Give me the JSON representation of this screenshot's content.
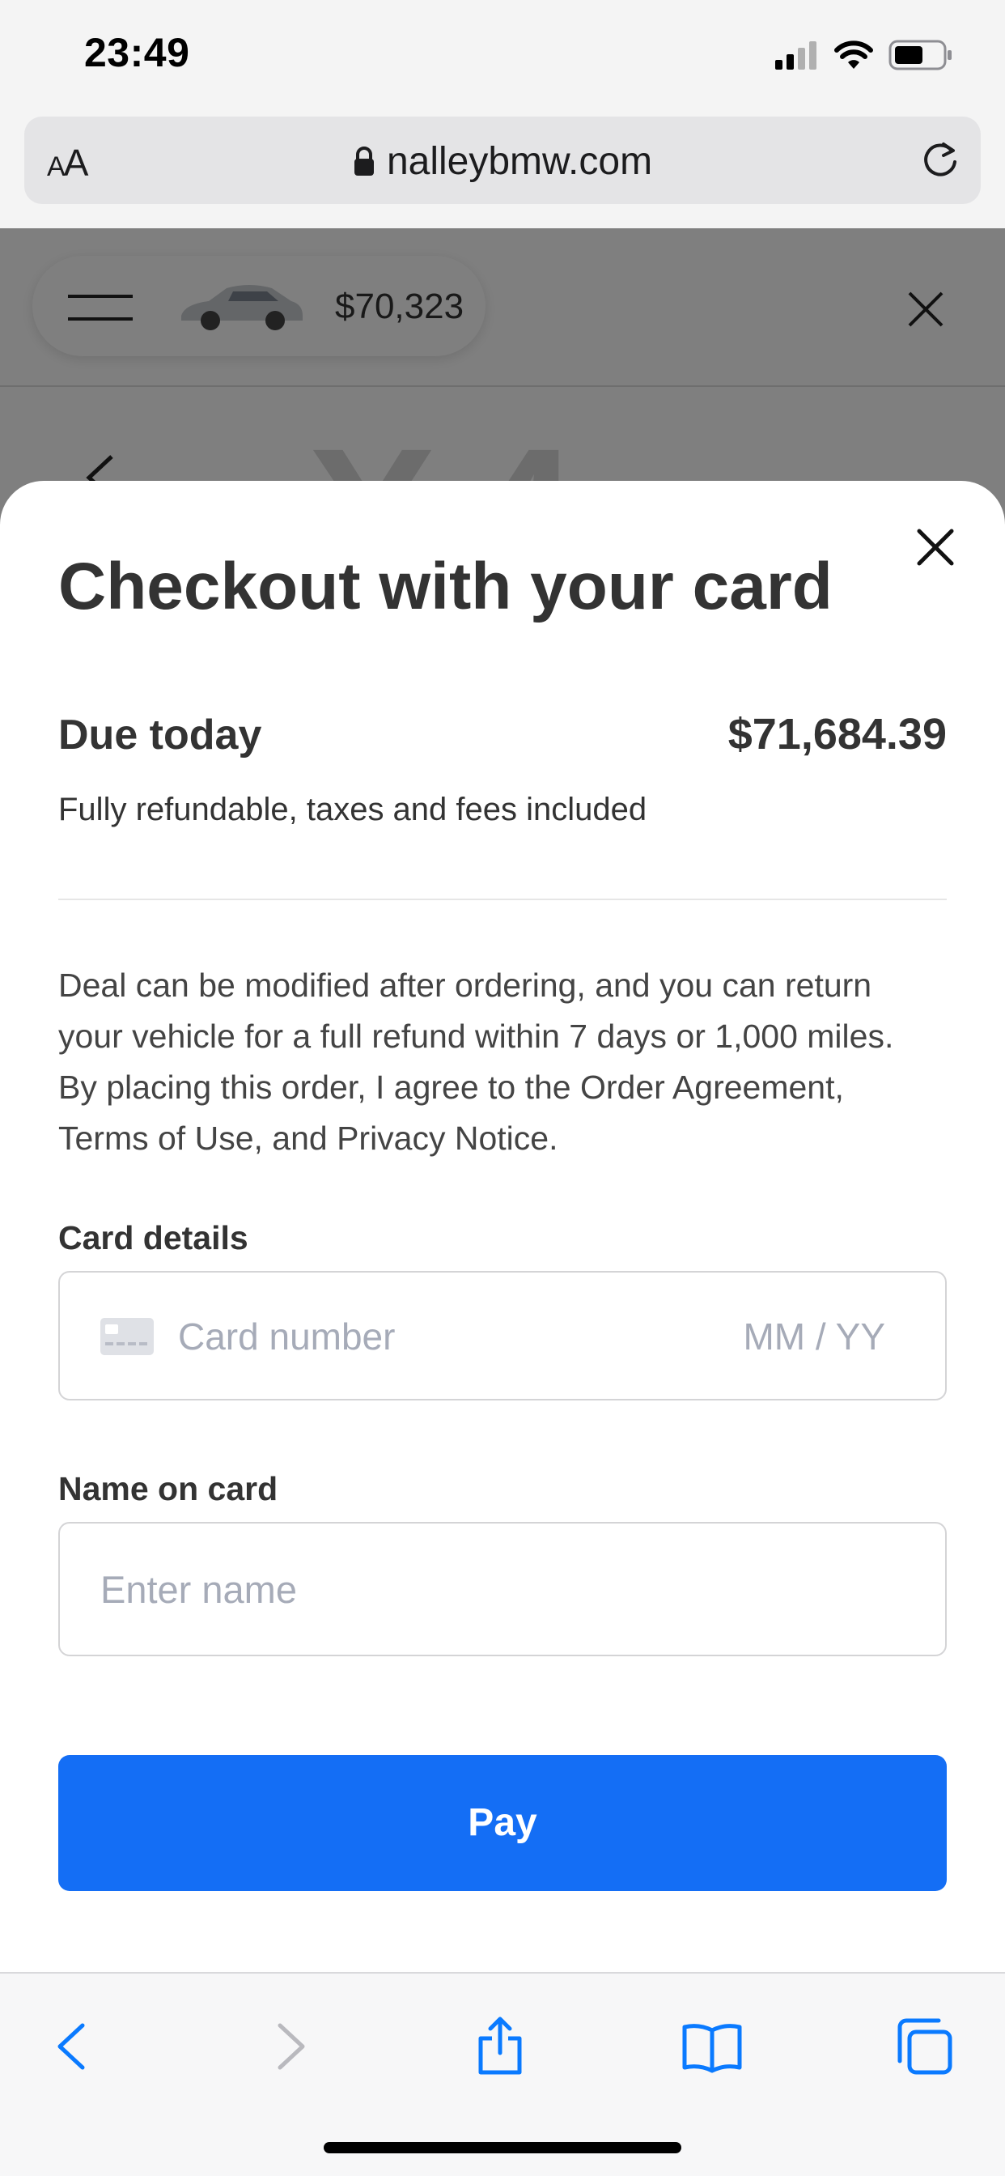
{
  "status_bar": {
    "time": "23:49"
  },
  "browser": {
    "text_size_label_small": "A",
    "text_size_label_large": "A",
    "url": "nalleybmw.com"
  },
  "background_page": {
    "header_price": "$70,323",
    "big_title": "X4"
  },
  "checkout": {
    "title": "Checkout with your card",
    "due_label": "Due today",
    "due_amount": "$71,684.39",
    "due_note": "Fully refundable, taxes and fees included",
    "disclaimer": "Deal can be modified after ordering, and you can return your vehicle for a full refund within 7 days or 1,000 miles. By placing this order, I agree to the Order Agreement, Terms of Use, and Privacy Notice.",
    "card_details_label": "Card details",
    "card_number_placeholder": "Card number",
    "card_expiry_placeholder": "MM / YY",
    "name_label": "Name on card",
    "name_placeholder": "Enter name",
    "pay_label": "Pay"
  },
  "colors": {
    "accent": "#146ef5",
    "safari_tint": "#0a7aff",
    "placeholder": "#a6abb8",
    "text": "#333333"
  },
  "icons": {
    "status": [
      "cellular-signal-icon",
      "wifi-icon",
      "battery-icon"
    ],
    "browser": [
      "lock-icon",
      "reload-icon"
    ],
    "toolbar": [
      "back-arrow-icon",
      "forward-arrow-icon",
      "share-icon",
      "bookmarks-icon",
      "tabs-icon"
    ]
  }
}
